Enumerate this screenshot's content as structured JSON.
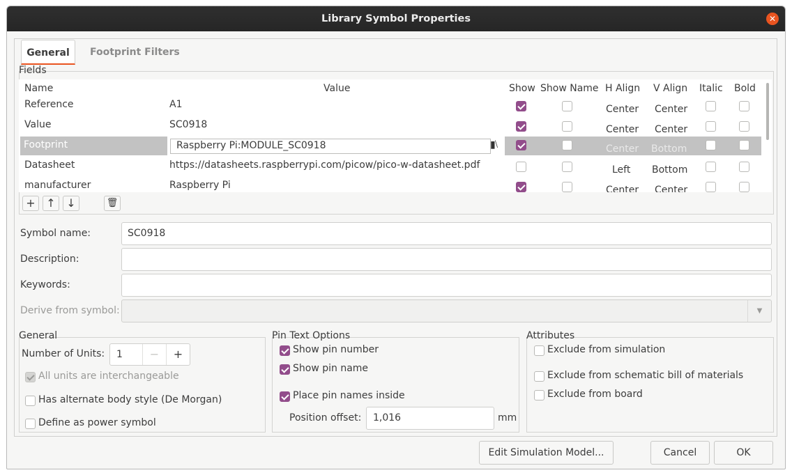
{
  "window": {
    "title": "Library Symbol Properties"
  },
  "tabs": [
    {
      "label": "General",
      "active": true
    },
    {
      "label": "Footprint Filters",
      "active": false
    }
  ],
  "fields": {
    "group_label": "Fields",
    "columns": [
      "Name",
      "Value",
      "Show",
      "Show Name",
      "H Align",
      "V Align",
      "Italic",
      "Bold"
    ],
    "rows": [
      {
        "name": "Reference",
        "value": "A1",
        "show": true,
        "show_name": false,
        "h_align": "Center",
        "v_align": "Center",
        "italic": false,
        "bold": false
      },
      {
        "name": "Value",
        "value": "SC0918",
        "show": true,
        "show_name": false,
        "h_align": "Center",
        "v_align": "Center",
        "italic": false,
        "bold": false
      },
      {
        "name": "Footprint",
        "value": "Raspberry Pi:MODULE_SC0918",
        "show": true,
        "show_name": false,
        "h_align": "Center",
        "v_align": "Bottom",
        "italic": false,
        "bold": false,
        "selected": true
      },
      {
        "name": "Datasheet",
        "value": "https://datasheets.raspberrypi.com/picow/pico-w-datasheet.pdf",
        "show": false,
        "show_name": false,
        "h_align": "Left",
        "v_align": "Bottom",
        "italic": false,
        "bold": false
      },
      {
        "name": "manufacturer",
        "value": "Raspberry Pi",
        "show": true,
        "show_name": false,
        "h_align": "Center",
        "v_align": "Center",
        "italic": false,
        "bold": false
      }
    ],
    "toolbar_icons": [
      "add-icon",
      "move-up-icon",
      "move-down-icon",
      "delete-icon"
    ]
  },
  "form": {
    "symbol_name_label": "Symbol name:",
    "symbol_name_value": "SC0918",
    "description_label": "Description:",
    "description_value": "",
    "keywords_label": "Keywords:",
    "keywords_value": "",
    "derive_label": "Derive from symbol:",
    "derive_value": ""
  },
  "general": {
    "label": "General",
    "units_label": "Number of Units:",
    "units_value": "1",
    "interchangeable_label": "All units are interchangeable",
    "interchangeable": true,
    "alternate_label": "Has alternate body style (De Morgan)",
    "alternate": false,
    "power_label": "Define as power symbol",
    "power": false
  },
  "pin_text": {
    "label": "Pin Text Options",
    "show_number_label": "Show pin number",
    "show_number": true,
    "show_name_label": "Show pin name",
    "show_name": true,
    "place_inside_label": "Place pin names inside",
    "place_inside": true,
    "offset_label": "Position offset:",
    "offset_value": "1,016",
    "offset_unit": "mm"
  },
  "attributes": {
    "label": "Attributes",
    "excl_sim_label": "Exclude from simulation",
    "excl_sim": false,
    "excl_bom_label": "Exclude from schematic bill of materials",
    "excl_bom": false,
    "excl_board_label": "Exclude from board",
    "excl_board": false
  },
  "buttons": {
    "edit_sim": "Edit Simulation Model...",
    "cancel": "Cancel",
    "ok": "OK"
  },
  "colors": {
    "accent": "#e95420",
    "check": "#924d8b",
    "titlebar": "#2c2c2c"
  }
}
